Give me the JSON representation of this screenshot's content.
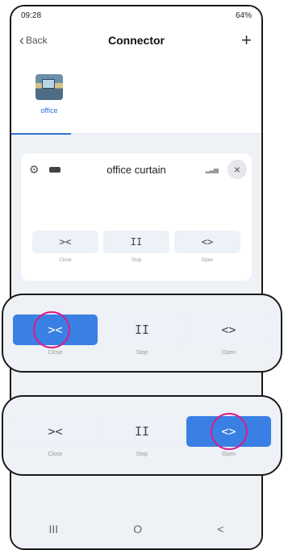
{
  "status": {
    "time": "09:28",
    "right": "64%"
  },
  "nav": {
    "back_label": "Back",
    "title": "Connector",
    "add_symbol": "+"
  },
  "room": {
    "label": "office"
  },
  "device": {
    "name": "office curtain",
    "close_symbol": "×",
    "controls": [
      {
        "symbol": "><",
        "label": "Close"
      },
      {
        "symbol": "II",
        "label": "Stop"
      },
      {
        "symbol": "<>",
        "label": "Open"
      }
    ]
  },
  "callout_close": {
    "active": "Close",
    "controls": [
      {
        "symbol": "><",
        "label": "Close"
      },
      {
        "symbol": "II",
        "label": "Stop"
      },
      {
        "symbol": "<>",
        "label": "Open"
      }
    ]
  },
  "callout_open": {
    "active": "Open",
    "controls": [
      {
        "symbol": "><",
        "label": "Close"
      },
      {
        "symbol": "II",
        "label": "Stop"
      },
      {
        "symbol": "<>",
        "label": "Open"
      }
    ]
  },
  "colors": {
    "accent": "#3a80e4",
    "highlight_ring": "#d81b8a"
  },
  "android_nav": {
    "recents": "III",
    "home": "O",
    "back": "<"
  }
}
